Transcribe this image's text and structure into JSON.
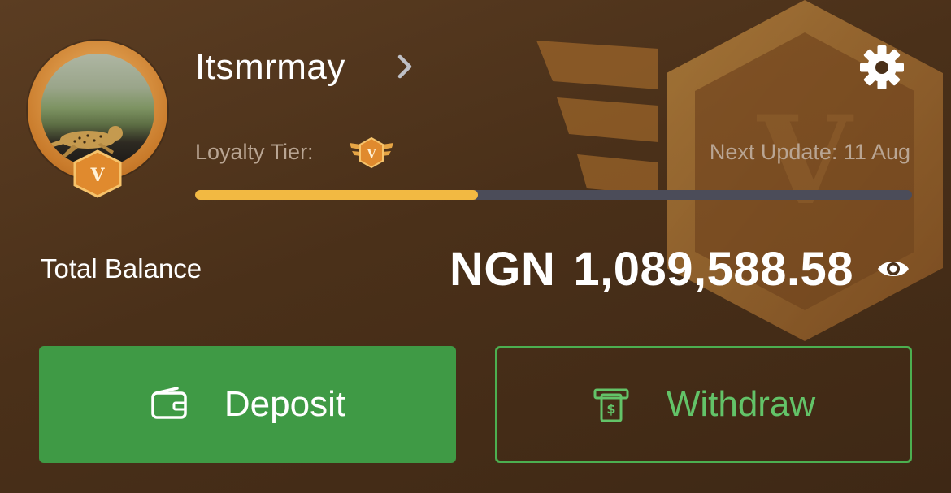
{
  "profile": {
    "username": "Itsmrmay",
    "tier_label": "Loyalty Tier:",
    "tier_letter": "V",
    "next_update": "Next Update: 11 Aug",
    "progress_fraction": 0.395
  },
  "balance": {
    "label": "Total Balance",
    "currency": "NGN",
    "amount": "1,089,588.58"
  },
  "actions": {
    "deposit_label": "Deposit",
    "withdraw_label": "Withdraw"
  },
  "icons": [
    "avatar",
    "tier-badge-icon",
    "chevron-right-icon",
    "gear-icon",
    "eye-icon",
    "wallet-icon",
    "cash-withdraw-icon"
  ],
  "colors": {
    "background": "#4a3019",
    "progress": "#f2b942",
    "progress_track": "#4b4c59",
    "deposit_bg": "#3f9a45",
    "withdraw_border": "#4caf50",
    "withdraw_text": "#63c368"
  }
}
